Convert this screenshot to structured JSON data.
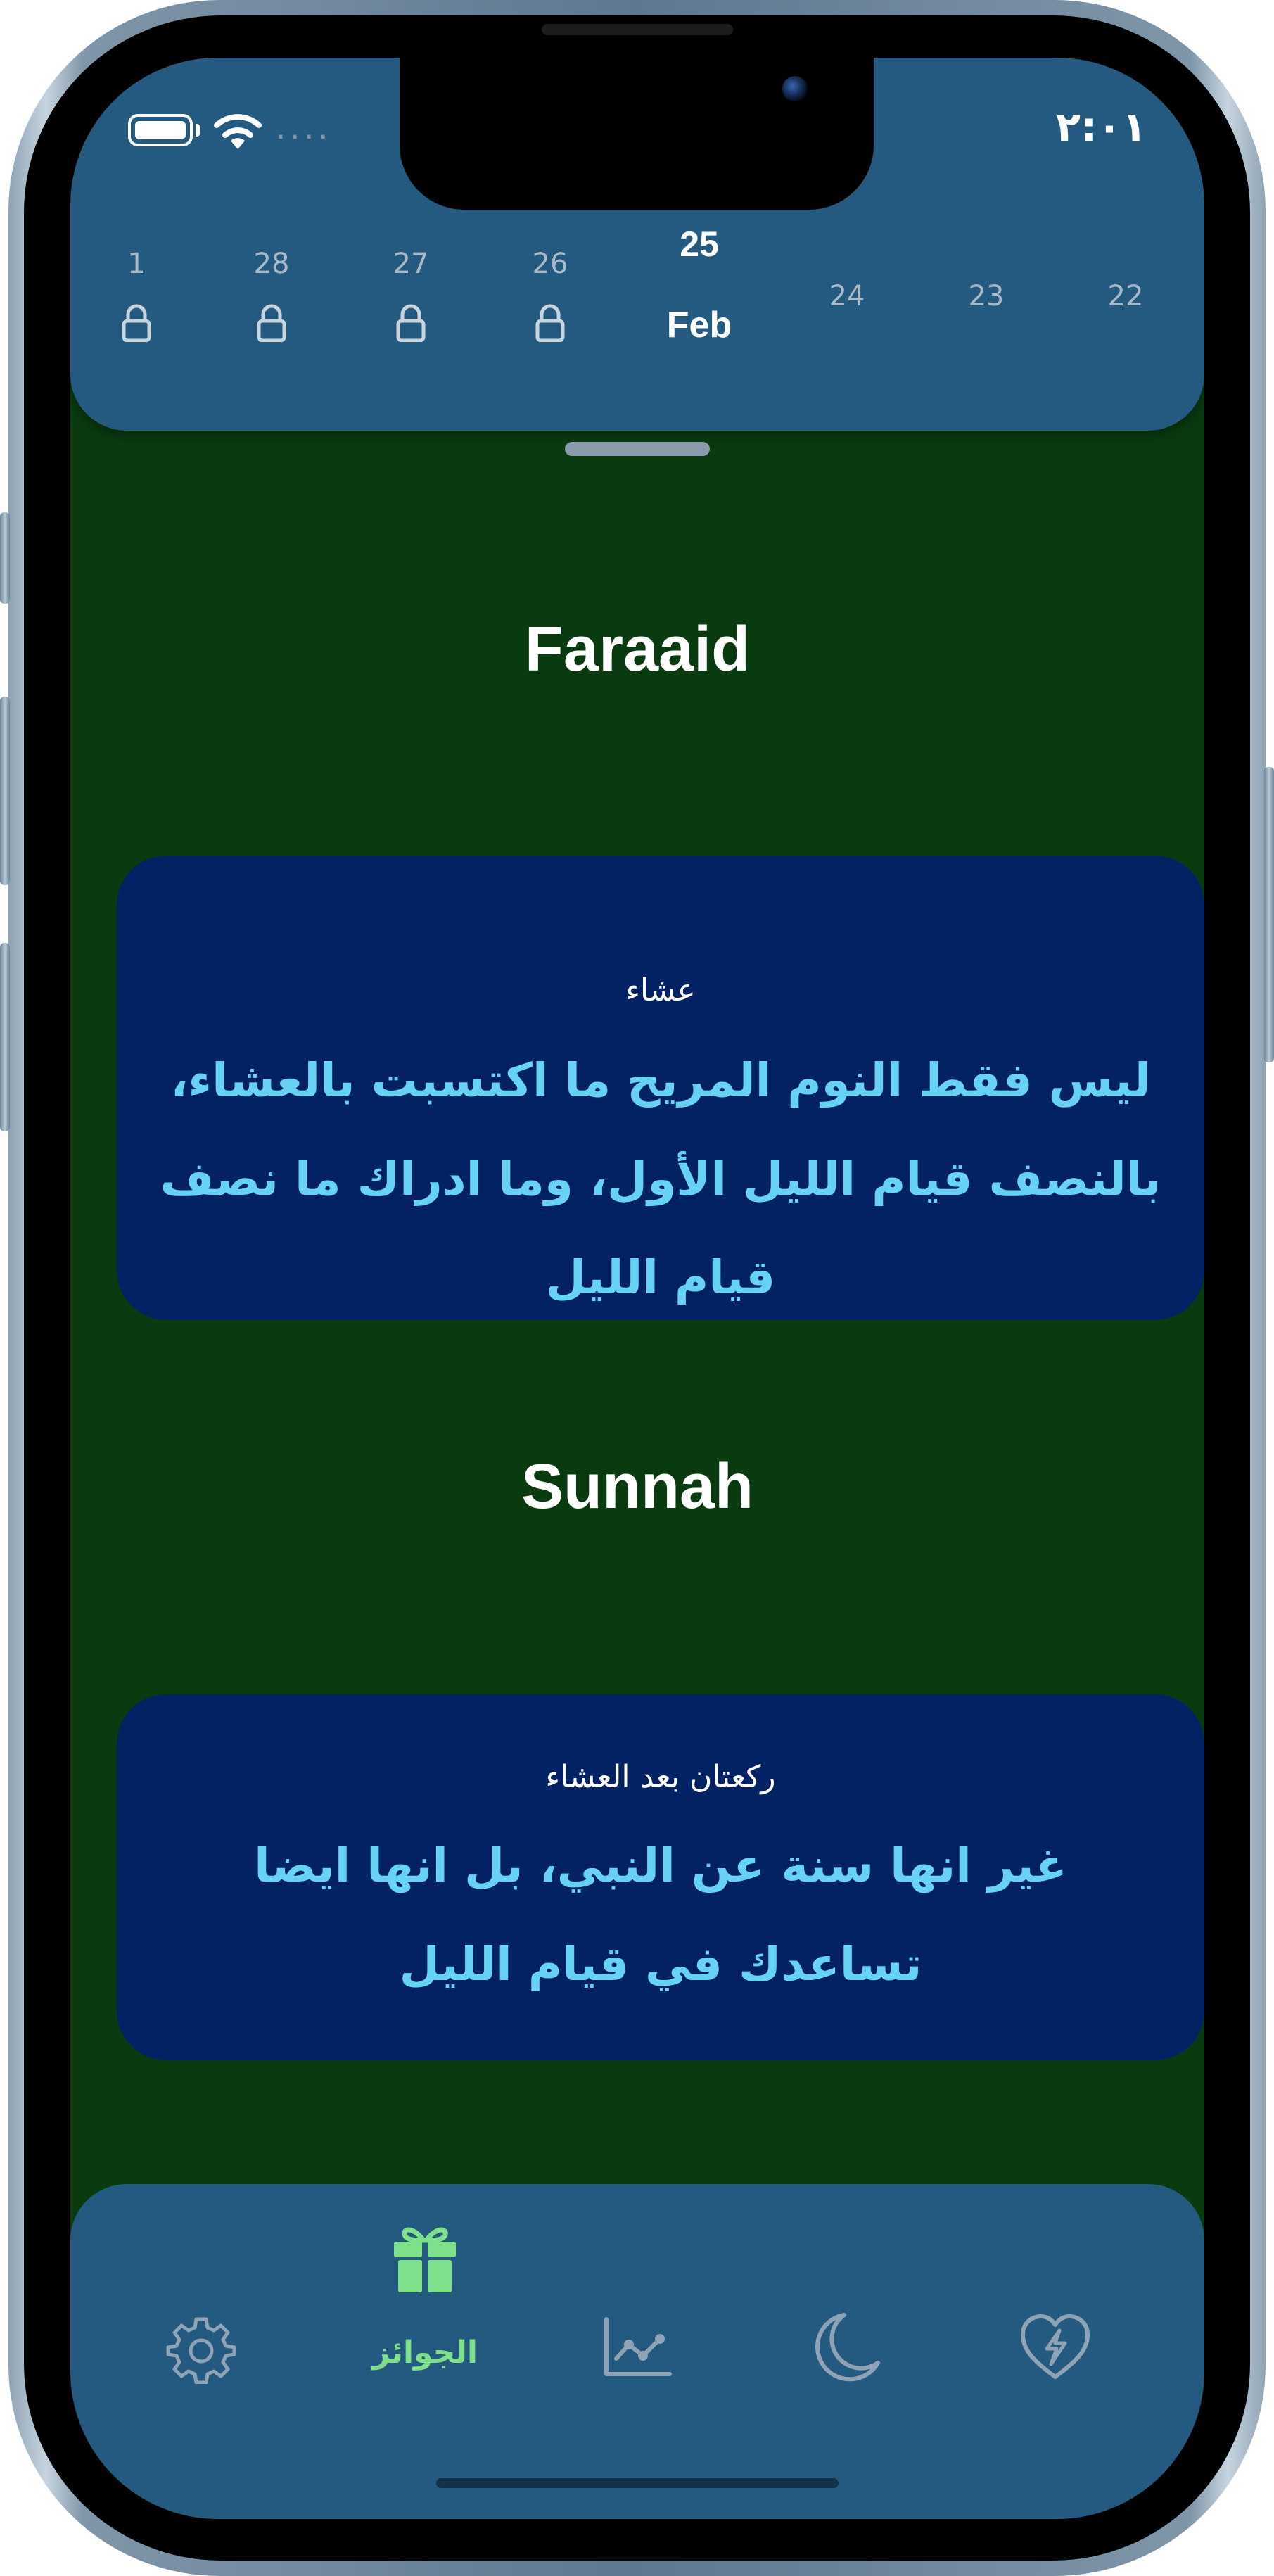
{
  "status_bar": {
    "clock": "٢:٠١",
    "signal_dots": "....",
    "battery_icon": "battery-icon",
    "wifi_icon": "wifi-icon"
  },
  "date_strip": {
    "days": [
      {
        "number": "1",
        "locked": true
      },
      {
        "number": "28",
        "locked": true
      },
      {
        "number": "27",
        "locked": true
      },
      {
        "number": "26",
        "locked": true
      },
      {
        "number": "25",
        "month": "Feb",
        "current": true
      },
      {
        "number": "24",
        "locked": false
      },
      {
        "number": "23",
        "locked": false
      },
      {
        "number": "22",
        "locked": false
      }
    ]
  },
  "sections": [
    {
      "title": "Faraaid",
      "card": {
        "subtitle": "عشاء",
        "body": "ليس فقط النوم المريح ما اكتسبت بالعشاء، بالنصف قيام الليل الأول، وما ادراك ما نصف قيام الليل"
      }
    },
    {
      "title": "Sunnah",
      "card": {
        "subtitle": "ركعتان بعد العشاء",
        "body": "غير انها سنة عن النبي، بل انها ايضا تساعدك في قيام الليل"
      }
    }
  ],
  "tab_bar": {
    "tabs": [
      {
        "icon": "gear-icon",
        "label": ""
      },
      {
        "icon": "gift-icon",
        "label": "الجوائز",
        "active": true
      },
      {
        "icon": "chart-icon",
        "label": ""
      },
      {
        "icon": "moon-icon",
        "label": ""
      },
      {
        "icon": "heart-bolt-icon",
        "label": ""
      }
    ]
  },
  "colors": {
    "background": "#0a3b10",
    "header": "#245a7f",
    "card": "#022263",
    "card_text": "#66d3f4",
    "active_tab": "#7ee08a",
    "inactive_tab": "#8fa3b6"
  }
}
